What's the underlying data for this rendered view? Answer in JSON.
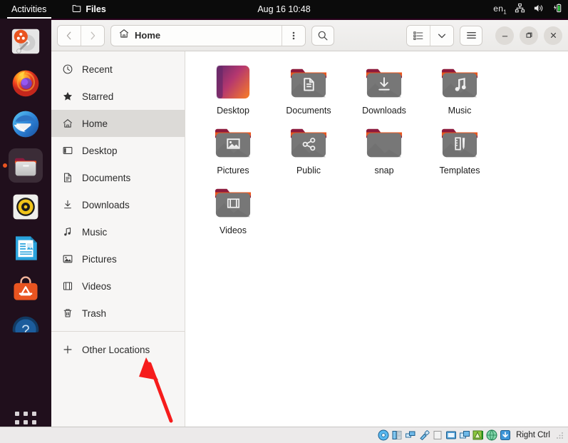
{
  "topbar": {
    "activities": "Activities",
    "app_name": "Files",
    "app_icon": "files-window-icon",
    "clock": "Aug 16  10:48",
    "language": "en",
    "language_sub": "1",
    "indicators": [
      "network-icon",
      "volume-icon",
      "battery-charging-icon"
    ]
  },
  "dock": {
    "items": [
      {
        "name": "ubuntu-install-disk",
        "label": "Install Ubuntu",
        "running": false
      },
      {
        "name": "firefox",
        "label": "Firefox",
        "running": false
      },
      {
        "name": "thunderbird",
        "label": "Thunderbird Mail",
        "running": false
      },
      {
        "name": "files",
        "label": "Files",
        "running": true
      },
      {
        "name": "rhythmbox",
        "label": "Rhythmbox",
        "running": false
      },
      {
        "name": "libreoffice-writer",
        "label": "LibreOffice Writer",
        "running": false
      },
      {
        "name": "ubuntu-software",
        "label": "Ubuntu Software",
        "running": false
      },
      {
        "name": "help",
        "label": "Help",
        "running": false
      }
    ],
    "show_apps_label": "Show Applications"
  },
  "window": {
    "title": "Home",
    "headerbar": {
      "back_label": "Back",
      "forward_label": "Forward",
      "path_icon": "home-icon",
      "path_label": "Home",
      "menu_label": "View options",
      "search_label": "Search",
      "view_list_label": "List view",
      "view_dropdown_label": "View options",
      "hamburger_label": "Main menu",
      "minimize_label": "Minimize",
      "maximize_label": "Maximize",
      "close_label": "Close"
    },
    "sidebar": {
      "items": [
        {
          "label": "Recent",
          "icon": "clock-icon",
          "selected": false
        },
        {
          "label": "Starred",
          "icon": "star-icon",
          "selected": false
        },
        {
          "label": "Home",
          "icon": "home-icon",
          "selected": true
        },
        {
          "label": "Desktop",
          "icon": "desktop-icon",
          "selected": false
        },
        {
          "label": "Documents",
          "icon": "document-icon",
          "selected": false
        },
        {
          "label": "Downloads",
          "icon": "download-icon",
          "selected": false
        },
        {
          "label": "Music",
          "icon": "music-note-icon",
          "selected": false
        },
        {
          "label": "Pictures",
          "icon": "picture-icon",
          "selected": false
        },
        {
          "label": "Videos",
          "icon": "film-icon",
          "selected": false
        },
        {
          "label": "Trash",
          "icon": "trash-icon",
          "selected": false
        }
      ],
      "other_locations": {
        "label": "Other Locations",
        "icon": "plus-icon"
      }
    },
    "files": [
      {
        "name": "Desktop",
        "icon": "desktop-gradient-icon",
        "type": "special"
      },
      {
        "name": "Documents",
        "icon": "document-icon",
        "type": "folder"
      },
      {
        "name": "Downloads",
        "icon": "download-icon",
        "type": "folder"
      },
      {
        "name": "Music",
        "icon": "music-note-icon",
        "type": "folder"
      },
      {
        "name": "Pictures",
        "icon": "picture-icon",
        "type": "folder"
      },
      {
        "name": "Public",
        "icon": "share-icon",
        "type": "folder"
      },
      {
        "name": "snap",
        "icon": "",
        "type": "folder"
      },
      {
        "name": "Templates",
        "icon": "template-icon",
        "type": "folder"
      },
      {
        "name": "Videos",
        "icon": "film-icon",
        "type": "folder"
      }
    ]
  },
  "annotation": {
    "type": "arrow",
    "color": "#f61c1c",
    "points_to": "Other Locations"
  },
  "vbox_statusbar": {
    "icons": [
      "optical-disc-icon",
      "floppy-icon",
      "network-icon",
      "usb-icon",
      "sheet-icon",
      "display-icon",
      "shared-folder-icon",
      "mouse-integration-icon",
      "globe-icon",
      "capture-icon"
    ],
    "host_key": "Right Ctrl"
  },
  "colors": {
    "ubuntu_orange": "#e95420",
    "topbar_bg": "#0b0b0b",
    "dock_bg": "#201018",
    "window_bg": "#ffffff",
    "sidebar_bg": "#f7f6f5",
    "selected_bg": "#dcdad7",
    "annotation_red": "#f61c1c",
    "folder_gray": "#777777",
    "folder_tab": "#8d1b3d"
  }
}
